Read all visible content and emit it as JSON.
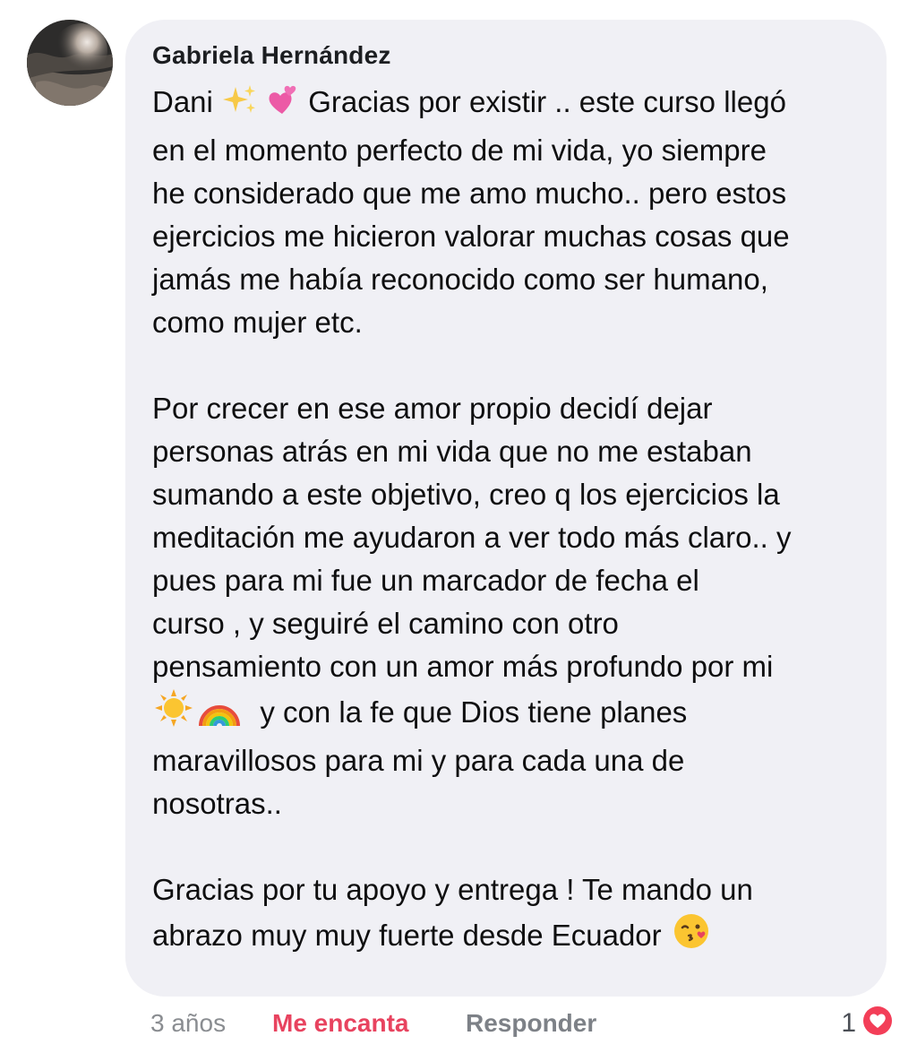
{
  "comment": {
    "author": "Gabriela Hernández",
    "paragraphs": [
      {
        "lines": [
          {
            "segments": [
              {
                "text": "Dani "
              },
              {
                "icon": "sparkles-icon"
              },
              {
                "icon": "two-hearts-icon"
              },
              {
                "text": " Gracias por existir .. este curso llegó"
              }
            ]
          },
          {
            "segments": [
              {
                "text": "en el momento perfecto de mi vida, yo siempre"
              }
            ]
          },
          {
            "segments": [
              {
                "text": "he considerado que me amo mucho.. pero estos"
              }
            ]
          },
          {
            "segments": [
              {
                "text": "ejercicios me hicieron valorar muchas cosas que"
              }
            ]
          },
          {
            "segments": [
              {
                "text": "jamás me había reconocido como ser humano,"
              }
            ]
          },
          {
            "segments": [
              {
                "text": "como mujer etc."
              }
            ]
          }
        ]
      },
      {
        "lines": [
          {
            "segments": [
              {
                "text": "Por crecer en ese amor propio decidí dejar"
              }
            ]
          },
          {
            "segments": [
              {
                "text": "personas atrás en mi vida que no me estaban"
              }
            ]
          },
          {
            "segments": [
              {
                "text": "sumando a este objetivo, creo q los ejercicios la"
              }
            ]
          },
          {
            "segments": [
              {
                "text": "meditación me ayudaron a ver todo más claro.. y"
              }
            ]
          },
          {
            "segments": [
              {
                "text": "pues para mi fue un marcador de fecha el"
              }
            ]
          },
          {
            "segments": [
              {
                "text": "curso , y seguiré el camino con otro"
              }
            ]
          },
          {
            "segments": [
              {
                "text": "pensamiento con un amor más profundo por mi"
              }
            ]
          },
          {
            "segments": [
              {
                "icon": "sun-icon"
              },
              {
                "icon": "rainbow-icon"
              },
              {
                "text": "  y con la fe que Dios tiene planes"
              }
            ]
          },
          {
            "segments": [
              {
                "text": "maravillosos para mi y para cada una de"
              }
            ]
          },
          {
            "segments": [
              {
                "text": "nosotras.."
              }
            ]
          }
        ]
      },
      {
        "lines": [
          {
            "segments": [
              {
                "text": "Gracias por tu apoyo y entrega ! Te mando un"
              }
            ]
          },
          {
            "segments": [
              {
                "text": "abrazo muy muy fuerte desde Ecuador "
              },
              {
                "icon": "kissing-face-icon"
              }
            ]
          }
        ]
      }
    ]
  },
  "footer": {
    "time": "3 años",
    "like_label": "Me encanta",
    "reply_label": "Responder",
    "reaction_count": "1",
    "reaction_icon": "love-reaction-icon"
  },
  "colors": {
    "bubble": "#f0f0f5",
    "like": "#e8435f",
    "muted": "#8a8d91",
    "reaction_heart": "#f33e58"
  }
}
